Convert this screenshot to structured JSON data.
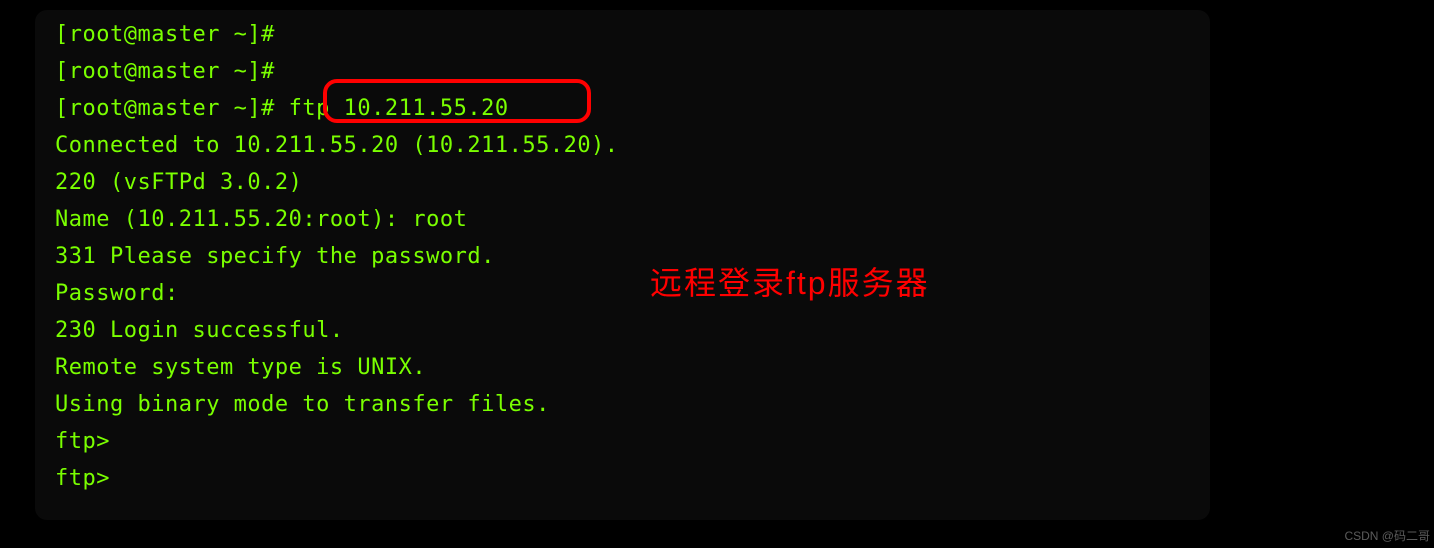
{
  "terminal": {
    "lines": [
      "[root@master ~]#",
      "[root@master ~]#",
      "[root@master ~]# ftp 10.211.55.20",
      "Connected to 10.211.55.20 (10.211.55.20).",
      "220 (vsFTPd 3.0.2)",
      "Name (10.211.55.20:root): root",
      "331 Please specify the password.",
      "Password:",
      "230 Login successful.",
      "Remote system type is UNIX.",
      "Using binary mode to transfer files.",
      "ftp>",
      "ftp>"
    ]
  },
  "annotation": {
    "text": "远程登录ftp服务器"
  },
  "highlighted_command": "ftp 10.211.55.20",
  "watermark": "CSDN @码二哥"
}
